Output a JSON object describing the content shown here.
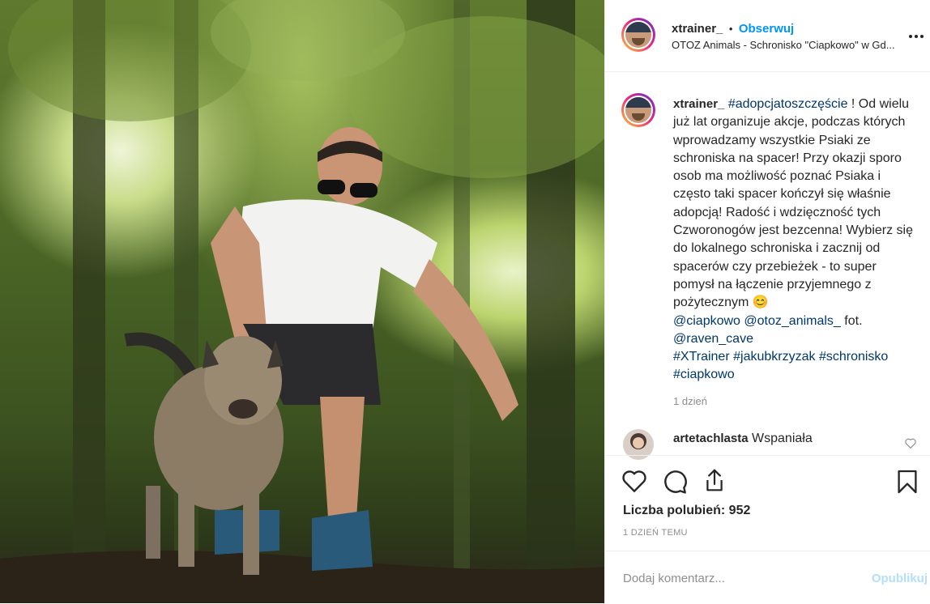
{
  "header": {
    "username": "xtrainer_",
    "dot": "•",
    "follow_label": "Obserwuj",
    "location": "OTOZ Animals - Schronisko \"Ciapkowo\" w Gd...",
    "more_icon": "more-options-icon"
  },
  "caption": {
    "username": "xtrainer_",
    "hashtag1": "#adopcjatoszczęście",
    "text": " ! Od wielu już lat organizuje akcje, podczas których wprowadzamy wszystkie Psiaki ze schroniska na spacer! Przy okazji sporo osob ma możliwość poznać Psiaka i często taki spacer kończył się właśnie adopcją! Radość i wdzięczność tych Czworonogów jest bezcenna! Wybierz się do lokalnego schroniska i zacznij od spacerów czy przebieżek - to super pomysł na łączenie przyjemnego z pożytecznym ",
    "emoji": "😊",
    "mention1": "@ciapkowo",
    "mention2": "@otoz_animals_",
    "fot": " fot.",
    "mention3": "@raven_cave",
    "hashtag2": "#XTrainer",
    "hashtag3": "#jakubkrzyzak",
    "hashtag4": "#schronisko",
    "hashtag5": "#ciapkowo",
    "time_ago": "1 dzień"
  },
  "comment": {
    "username": "artetachlasta",
    "text": "Wspaniała"
  },
  "actions": {
    "like_icon": "heart-icon",
    "comment_icon": "comment-icon",
    "share_icon": "share-icon",
    "save_icon": "bookmark-icon",
    "likes_label": "Liczba polubień: 952",
    "date": "1 DZIEŃ TEMU"
  },
  "add_comment": {
    "placeholder": "Dodaj komentarz...",
    "publish_label": "Opublikuj"
  },
  "colors": {
    "link": "#0095f6",
    "hashtag": "#00376b",
    "muted": "#8e8e8e"
  }
}
